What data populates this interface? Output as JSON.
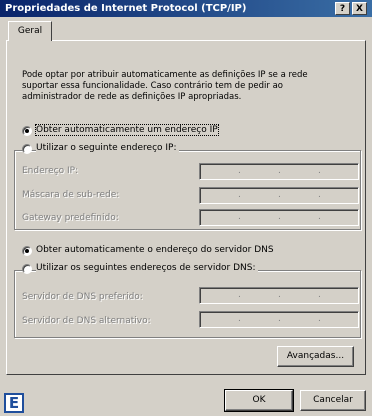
{
  "window": {
    "title": "Propriedades de Internet Protocol (TCP/IP)",
    "help_label": "?",
    "close_label": "X"
  },
  "tabs": [
    {
      "label": "Geral"
    }
  ],
  "description": "Pode optar por atribuir automaticamente as definições IP se a rede suportar essa funcionalidade. Caso contrário tem de pedir ao administrador de rede as definições IP apropriadas.",
  "ip": {
    "auto_label": "Obter automaticamente um endereço IP",
    "manual_label": "Utilizar o seguinte endereço IP:",
    "fields": [
      {
        "label": "Endereço IP:"
      },
      {
        "label": "Máscara de sub-rede:"
      },
      {
        "label": "Gateway predefinido:"
      }
    ]
  },
  "dns": {
    "auto_label": "Obter automaticamente o endereço do servidor DNS",
    "manual_label": "Utilizar os seguintes endereços de servidor DNS:",
    "fields": [
      {
        "label": "Servidor de DNS preferido:"
      },
      {
        "label": "Servidor de DNS alternativo:"
      }
    ]
  },
  "buttons": {
    "advanced": "Avançadas...",
    "ok": "OK",
    "cancel": "Cancelar"
  },
  "badge": "E",
  "ip_dot": "."
}
